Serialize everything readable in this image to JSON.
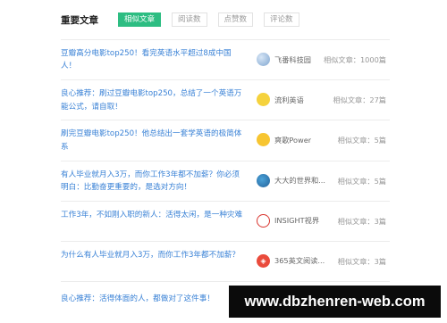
{
  "header": {
    "title": "重要文章",
    "tabs": [
      {
        "label": "相似文章",
        "active": true
      },
      {
        "label": "阅读数",
        "active": false
      },
      {
        "label": "点赞数",
        "active": false
      },
      {
        "label": "评论数",
        "active": false
      }
    ]
  },
  "articles": [
    {
      "title": "豆瓣高分电影top250！看完英语水平超过8成中国人！",
      "author": "飞番科技园",
      "count": "相似文章：1000篇",
      "avatar": "avatar-icon"
    },
    {
      "title": "良心推荐：刷过豆瓣电影top250，总结了一个英语万能公式，请自取！",
      "author": "流利英语",
      "count": "相似文章：27篇",
      "avatar": "avatar-icon"
    },
    {
      "title": "刷完豆瓣电影top250！他总结出一套学英语的极简体系",
      "author": "爽歌Power",
      "count": "相似文章：5篇",
      "avatar": "avatar-icon"
    },
    {
      "title": "有人毕业就月入3万，而你工作3年都不加薪？你必须明白：比勤奋更重要的，是选对方向！",
      "author": "大大的世界和...",
      "count": "相似文章：5篇",
      "avatar": "avatar-icon"
    },
    {
      "title": "工作3年，不如刚入职的新人：活得太闲，是一种灾难",
      "author": "INSIGHT视界",
      "count": "相似文章：3篇",
      "avatar": "insight-logo-icon"
    },
    {
      "title": "为什么有人毕业就月入3万，而你工作3年都不加薪？",
      "author": "365英文阅读...",
      "count": "相似文章：3篇",
      "avatar": "avatar-icon"
    },
    {
      "title": "良心推荐：活得体面的人，都做对了这件事！",
      "author": "",
      "count": "",
      "avatar": ""
    }
  ],
  "watermark": "www.dbzhenren-web.com",
  "colors": {
    "accent": "#2dbd82",
    "link": "#3a82d6",
    "muted": "#999999"
  }
}
